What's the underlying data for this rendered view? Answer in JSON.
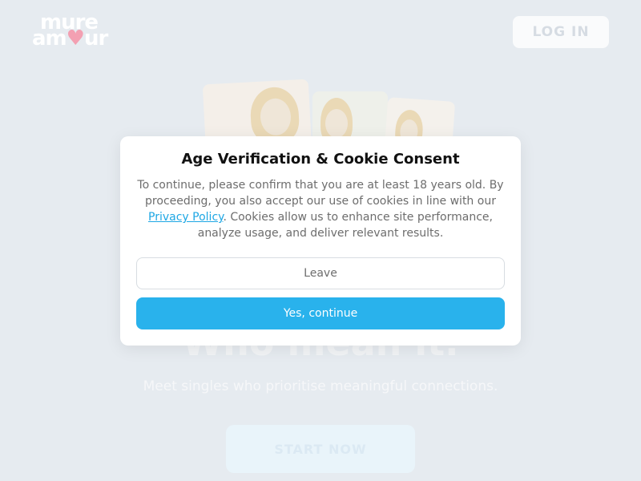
{
  "brand": {
    "logo_line1": "mure",
    "logo_line2_a": "am",
    "logo_heart": "♥",
    "logo_line2_b": "ur"
  },
  "header": {
    "login_label": "LOG IN"
  },
  "hero": {
    "headline": "Who mean it.",
    "subheadline": "Meet singles who prioritise meaningful connections.",
    "start_label": "START NOW"
  },
  "modal": {
    "title": "Age Verification & Cookie Consent",
    "body_before_link": "To continue, please confirm that you are at least 18 years old. By proceeding, you also accept our use of cookies in line with our ",
    "link_label": "Privacy Policy",
    "body_after_link": ". Cookies allow us to enhance site performance, analyze usage, and deliver relevant results.",
    "leave_label": "Leave",
    "continue_label": "Yes, continue"
  },
  "colors": {
    "accent": "#29b2ec",
    "background": "#e6ebf0",
    "heart": "#f3a0b2"
  }
}
